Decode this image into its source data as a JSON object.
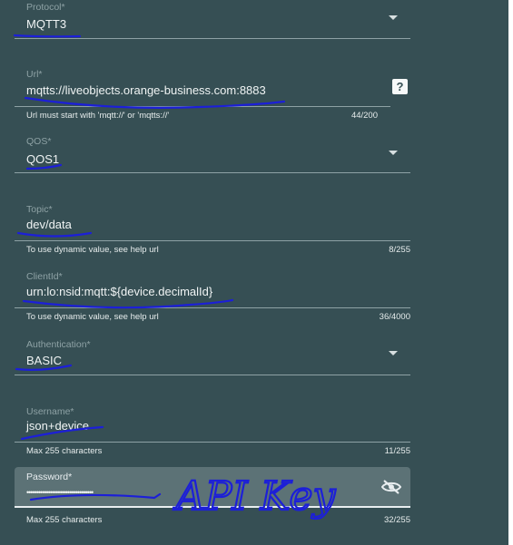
{
  "protocol": {
    "label": "Protocol*",
    "value": "MQTT3"
  },
  "url": {
    "label": "Url*",
    "value": "mqtts://liveobjects.orange-business.com:8883",
    "hint": "Url must start with 'mqtt://' or 'mqtts://'",
    "counter": "44/200",
    "help_icon": "?"
  },
  "qos": {
    "label": "QOS*",
    "value": "QOS1"
  },
  "topic": {
    "label": "Topic*",
    "value": "dev/data",
    "hint": "To use dynamic value, see help url",
    "counter": "8/255"
  },
  "client_id": {
    "label": "ClientId*",
    "value": "urn:lo:nsid:mqtt:${device.decimalId}",
    "hint": "To use dynamic value, see help url",
    "counter": "36/4000"
  },
  "authentication": {
    "label": "Authentication*",
    "value": "BASIC"
  },
  "username": {
    "label": "Username*",
    "value": "json+device",
    "hint": "Max 255 characters",
    "counter": "11/255"
  },
  "password": {
    "label": "Password*",
    "value": "••••••••••••••••••••••••••••••••••",
    "hint": "Max 255 characters",
    "counter": "32/255",
    "visibility_icon": "eye-off-icon"
  },
  "annotation": {
    "text": "API Key"
  },
  "colors": {
    "panel_bg": "#364f54",
    "active_field_bg": "#5c7276",
    "label": "#8ea2a5",
    "ink": "#1c1fd8"
  }
}
